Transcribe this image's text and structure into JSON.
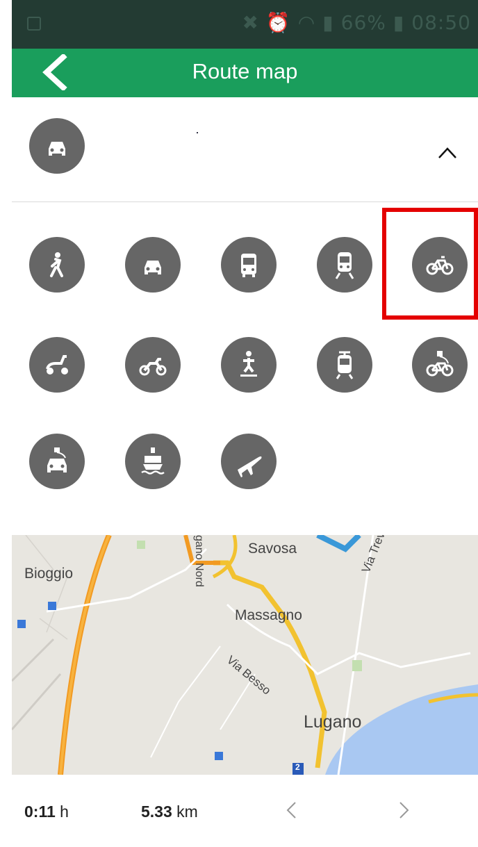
{
  "status": {
    "battery": "66%",
    "time": "08:50",
    "left_icon": "image-icon",
    "right_icons": [
      "mute-icon",
      "alarm-icon",
      "wifi-icon",
      "signal-icon",
      "battery-icon"
    ]
  },
  "header": {
    "title": "Route map",
    "back_icon": "chevron-left-icon",
    "color": "#1a9e5c"
  },
  "selected_mode": {
    "icon": "car-icon",
    "expand_icon": "chevron-up-icon"
  },
  "transport_modes": [
    {
      "icon": "walk-icon"
    },
    {
      "icon": "car-icon"
    },
    {
      "icon": "bus-icon"
    },
    {
      "icon": "train-icon"
    },
    {
      "icon": "bicycle-icon",
      "highlighted": true
    },
    {
      "icon": "scooter-icon"
    },
    {
      "icon": "motorbike-icon"
    },
    {
      "icon": "skateboard-icon"
    },
    {
      "icon": "tram-icon"
    },
    {
      "icon": "e-bike-icon"
    },
    {
      "icon": "electric-car-icon"
    },
    {
      "icon": "ship-icon"
    },
    {
      "icon": "airplane-icon"
    }
  ],
  "map": {
    "labels": [
      "Savosa",
      "Bioggio",
      "Massagno",
      "Via Trevano",
      "Via Besso",
      "Lugano",
      "gano Nord"
    ],
    "route_marker": "2"
  },
  "footer": {
    "duration_value": "0:11",
    "duration_unit": "h",
    "distance_value": "5.33",
    "distance_unit": "km",
    "prev_icon": "chevron-left-icon",
    "next_icon": "chevron-right-icon"
  }
}
